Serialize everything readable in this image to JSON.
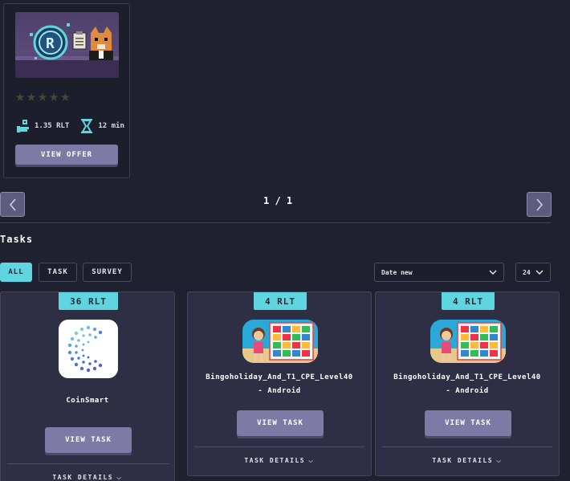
{
  "offer": {
    "rating_stars": 0,
    "reward": "1.35 RLT",
    "duration": "12 min",
    "button_label": "VIEW OFFER"
  },
  "pagination": {
    "indicator": "1 / 1"
  },
  "tasks": {
    "title": "Tasks",
    "filters": [
      "ALL",
      "TASK",
      "SURVEY"
    ],
    "active_filter": "ALL",
    "sort_value": "Date new",
    "page_size": "24",
    "items": [
      {
        "reward": "36 RLT",
        "name": "CoinSmart",
        "name2": "",
        "button_label": "VIEW TASK",
        "details_label": "TASK DETAILS"
      },
      {
        "reward": "4 RLT",
        "name": "Bingoholiday_And_T1_CPE_Level40",
        "name2": "- Android",
        "button_label": "VIEW TASK",
        "details_label": "TASK DETAILS"
      },
      {
        "reward": "4 RLT",
        "name": "Bingoholiday_And_T1_CPE_Level40",
        "name2": "- Android",
        "button_label": "VIEW TASK",
        "details_label": "TASK DETAILS"
      }
    ]
  },
  "colors": {
    "accent": "#5fd6df",
    "button": "#7e7aa6",
    "background": "#1f2030",
    "card": "#2e2f45"
  }
}
